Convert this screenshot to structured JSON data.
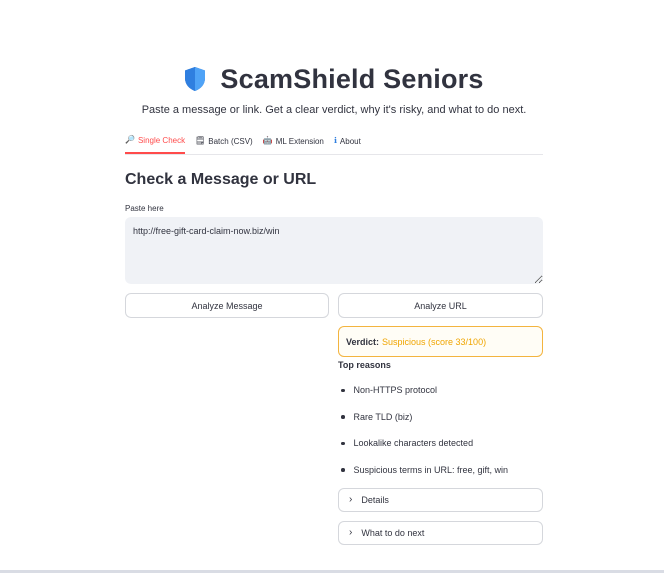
{
  "header": {
    "icon": "shield-icon",
    "title": "ScamShield Seniors",
    "subtitle": "Paste a message or link. Get a clear verdict, why it's risky, and what to do next."
  },
  "tabs": [
    {
      "icon_glyph": "🔎",
      "icon": "magnifier-icon",
      "label": "Single Check",
      "active": true
    },
    {
      "icon_glyph": "🗒",
      "icon": "notepad-icon",
      "label": "Batch (CSV)",
      "active": false
    },
    {
      "icon_glyph": "🤖",
      "icon": "robot-icon",
      "label": "ML Extension",
      "active": false
    },
    {
      "icon_glyph": "ℹ",
      "icon": "info-icon",
      "label": "About",
      "active": false
    }
  ],
  "main": {
    "heading": "Check a Message or URL",
    "input_label": "Paste here",
    "input_value": "http://free-gift-card-claim-now.biz/win",
    "analyze_message_label": "Analyze Message",
    "analyze_url_label": "Analyze URL"
  },
  "result": {
    "verdict_key": "Verdict:",
    "verdict_value": "Suspicious (score 33/100)",
    "reasons_title": "Top reasons",
    "reasons": [
      "Non-HTTPS protocol",
      "Rare TLD (biz)",
      "Lookalike characters detected",
      "Suspicious terms in URL: free, gift, win"
    ],
    "details_label": "Details",
    "next_label": "What to do next"
  },
  "colors": {
    "accent": "#ff4b4b",
    "warning": "#f0a500",
    "shield_blue": "#2f7fe0"
  }
}
